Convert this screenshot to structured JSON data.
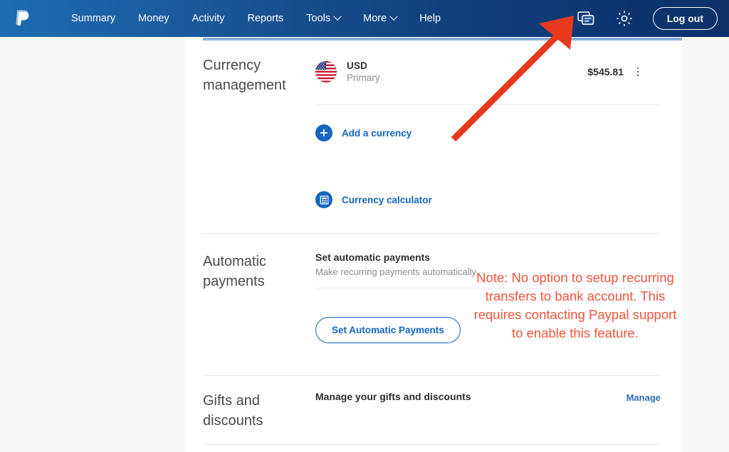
{
  "header": {
    "logo_name": "paypal-logo",
    "nav": [
      {
        "label": "Summary",
        "dropdown": false
      },
      {
        "label": "Money",
        "dropdown": false
      },
      {
        "label": "Activity",
        "dropdown": false
      },
      {
        "label": "Reports",
        "dropdown": false
      },
      {
        "label": "Tools",
        "dropdown": true
      },
      {
        "label": "More",
        "dropdown": true
      },
      {
        "label": "Help",
        "dropdown": false
      }
    ],
    "message_icon": "message-icon",
    "settings_icon": "gear-icon",
    "logout_label": "Log out",
    "background_start": "#1f6cb0",
    "background_end": "#0c3069"
  },
  "sections": {
    "currency": {
      "title": "Currency management",
      "rows": [
        {
          "flag_icon": "us-flag-icon",
          "code": "USD",
          "subtitle": "Primary",
          "amount": "$545.81",
          "menu_icon": "kebab-menu-icon"
        }
      ],
      "add_currency": {
        "icon": "plus-circle-icon",
        "label": "Add a currency"
      },
      "calculator": {
        "icon": "calculator-icon",
        "label": "Currency calculator"
      }
    },
    "automatic_payments": {
      "title": "Automatic payments",
      "heading": "Set automatic payments",
      "subtitle": "Make recurring payments automatically.",
      "button_label": "Set Automatic Payments"
    },
    "gifts": {
      "title": "Gifts and discounts",
      "heading": "Manage your gifts and discounts",
      "link_label": "Manage"
    }
  },
  "annotations": {
    "note_text": "Note: No option to setup recurring transfers to bank account. This requires contacting Paypal support to enable this feature.",
    "note_color": "#f4543c",
    "arrow_color": "#e8381e",
    "arrow_name": "red-arrow-pointing-to-message-icon"
  }
}
